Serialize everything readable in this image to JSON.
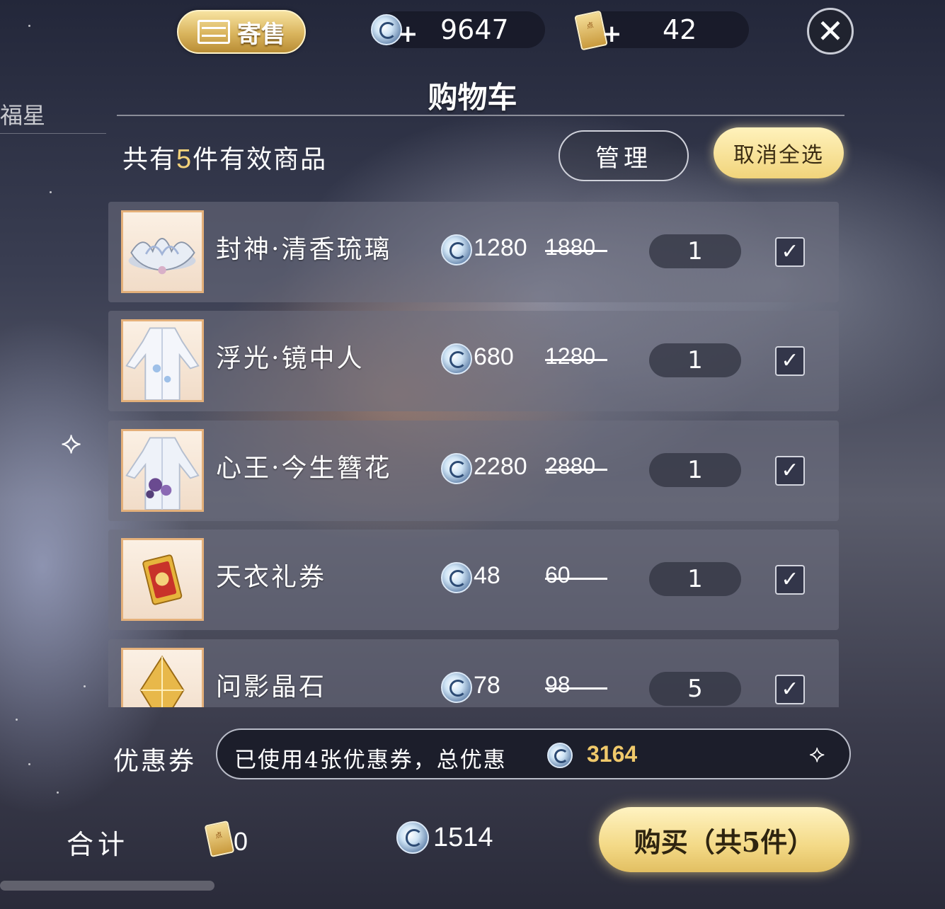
{
  "top_bar": {
    "consign_label": "寄售",
    "jade_amount": "9647",
    "points_amount": "42",
    "close_icon": "close-x"
  },
  "side": {
    "label": "福星"
  },
  "title": "购物车",
  "summary": {
    "prefix": "共有",
    "count": "5",
    "suffix": "件有效商品"
  },
  "buttons": {
    "manage": "管理",
    "deselect_all": "取消全选",
    "buy": "购买（共5件）"
  },
  "items": [
    {
      "name": "封神·清香琉璃",
      "price": "1280",
      "original": "1880",
      "qty": "1",
      "checked": true,
      "icon": "lotus-icon"
    },
    {
      "name": "浮光·镜中人",
      "price": "680",
      "original": "1280",
      "qty": "1",
      "checked": true,
      "icon": "white-robe-icon"
    },
    {
      "name": "心王·今生簪花",
      "price": "2280",
      "original": "2880",
      "qty": "1",
      "checked": true,
      "icon": "flower-robe-icon"
    },
    {
      "name": "天衣礼券",
      "price": "48",
      "original": "60",
      "qty": "1",
      "checked": true,
      "icon": "ticket-icon"
    },
    {
      "name": "问影晶石",
      "price": "78",
      "original": "98",
      "qty": "5",
      "checked": true,
      "icon": "crystal-icon"
    }
  ],
  "coupon": {
    "label": "优惠券",
    "text": "已使用4张优惠券，总优惠",
    "amount": "3164"
  },
  "total": {
    "label": "合计",
    "points": "0",
    "jade": "1514"
  },
  "colors": {
    "accent_gold": "#f1d47b",
    "coupon_amount": "#f0c96b",
    "summary_count": "#f4d27a"
  }
}
